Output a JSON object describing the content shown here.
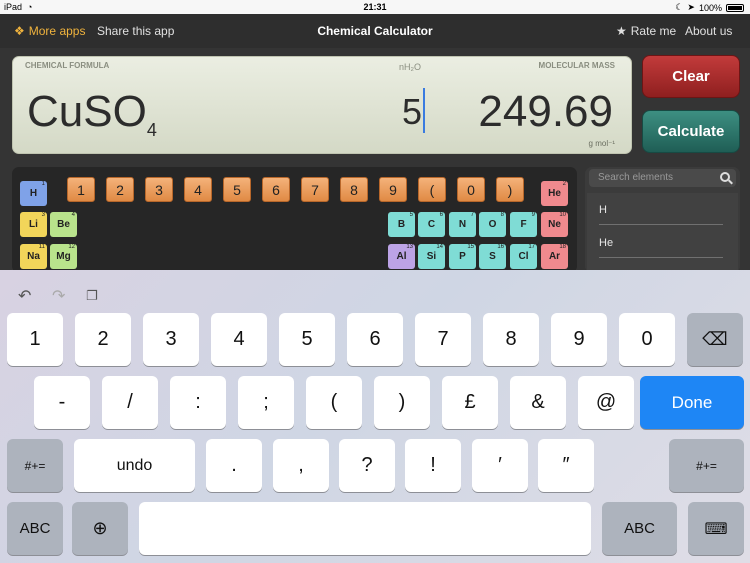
{
  "status_bar": {
    "device": "iPad",
    "time": "21:31",
    "battery": "100%"
  },
  "nav": {
    "more_apps": "More apps",
    "share": "Share this app",
    "title": "Chemical Calculator",
    "rate": "Rate me",
    "about": "About us"
  },
  "display": {
    "formula_label": "CHEMICAL FORMULA",
    "hydrate_label": "nH₂O",
    "mass_label": "MOLECULAR MASS",
    "formula_main": "CuSO",
    "formula_sub": "4",
    "hydrate_value": "5",
    "mass_value": "249.69",
    "unit": "g mol⁻¹"
  },
  "buttons": {
    "clear": "Clear",
    "calculate": "Calculate"
  },
  "number_keys": [
    "1",
    "2",
    "3",
    "4",
    "5",
    "6",
    "7",
    "8",
    "9",
    "(",
    "0",
    ")"
  ],
  "elements": [
    {
      "symbol": "H",
      "number": "1"
    },
    {
      "symbol": "He",
      "number": "2"
    },
    {
      "symbol": "Li",
      "number": "3"
    },
    {
      "symbol": "Be",
      "number": "4"
    },
    {
      "symbol": "B",
      "number": "5"
    },
    {
      "symbol": "C",
      "number": "6"
    },
    {
      "symbol": "N",
      "number": "7"
    },
    {
      "symbol": "O",
      "number": "8"
    },
    {
      "symbol": "F",
      "number": "9"
    },
    {
      "symbol": "Ne",
      "number": "10"
    },
    {
      "symbol": "Na",
      "number": "11"
    },
    {
      "symbol": "Mg",
      "number": "12"
    },
    {
      "symbol": "Al",
      "number": "13"
    },
    {
      "symbol": "Si",
      "number": "14"
    },
    {
      "symbol": "P",
      "number": "15"
    },
    {
      "symbol": "S",
      "number": "16"
    },
    {
      "symbol": "Cl",
      "number": "17"
    },
    {
      "symbol": "Ar",
      "number": "18"
    }
  ],
  "search": {
    "placeholder": "Search elements",
    "results": [
      "H",
      "He"
    ]
  },
  "keyboard": {
    "row1": [
      "1",
      "2",
      "3",
      "4",
      "5",
      "6",
      "7",
      "8",
      "9",
      "0"
    ],
    "row2": [
      "-",
      "/",
      ":",
      ";",
      "(",
      ")",
      "£",
      "&",
      "@"
    ],
    "done": "Done",
    "row3": [
      "undo",
      ".",
      ",",
      "?",
      "!",
      "′",
      "″"
    ],
    "shift_sym": "#+=",
    "abc": "ABC"
  },
  "colors": {
    "accent_orange": "#f0b33d",
    "clear": "#b03030",
    "calculate": "#2e7a6e",
    "done": "#1e86f5"
  }
}
